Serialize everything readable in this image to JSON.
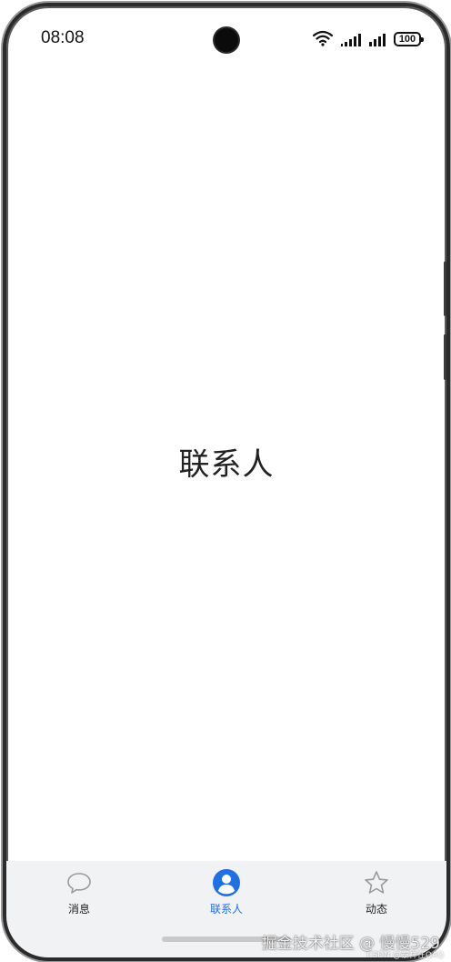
{
  "status_bar": {
    "time": "08:08",
    "battery": "100",
    "icons": [
      "wifi-icon",
      "signal-icon",
      "signal-icon",
      "battery-icon"
    ]
  },
  "main": {
    "title": "联系人"
  },
  "tabbar": {
    "tabs": [
      {
        "label": "消息",
        "icon": "chat-bubble-icon",
        "active": false
      },
      {
        "label": "联系人",
        "icon": "person-icon",
        "active": true
      },
      {
        "label": "动态",
        "icon": "star-icon",
        "active": false
      }
    ],
    "active_color": "#1f6fe5"
  },
  "watermark": {
    "main": "掘金技术社区 @ 慢慢529",
    "sub": "CSDN @泰祥在QAQ"
  }
}
